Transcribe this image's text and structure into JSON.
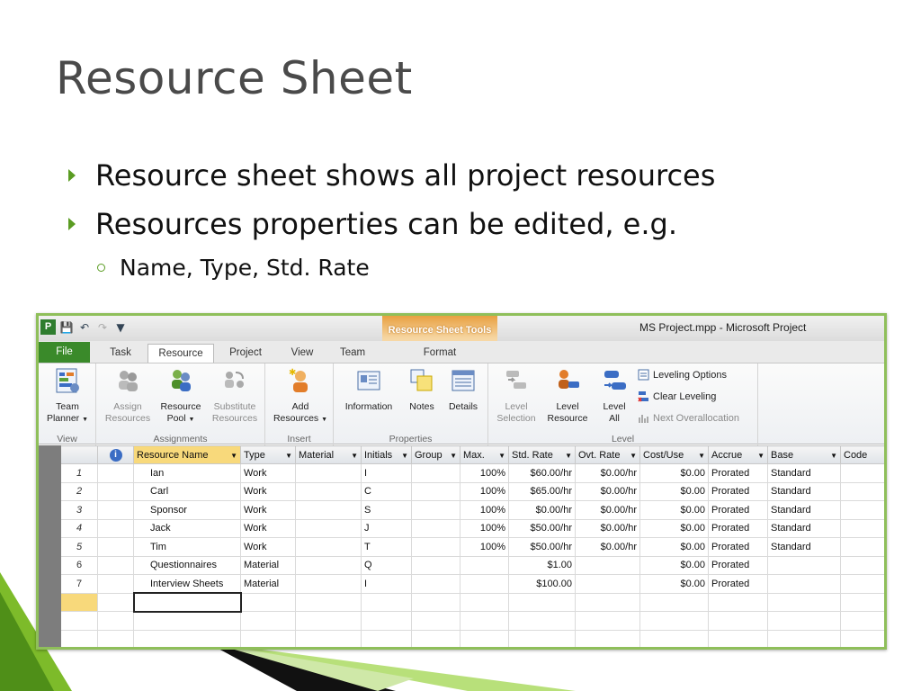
{
  "slide": {
    "title": "Resource Sheet",
    "bullets": [
      "Resource sheet shows all project resources",
      "Resources properties can be edited, e.g."
    ],
    "sub_bullet": "Name, Type, Std. Rate"
  },
  "app": {
    "window_title": "MS Project.mpp  -  Microsoft Project",
    "context_tab": "Resource Sheet Tools",
    "tabs": [
      "File",
      "Task",
      "Resource",
      "Project",
      "View",
      "Team",
      "Format"
    ],
    "active_tab": "Resource"
  },
  "ribbon": {
    "view": {
      "btn1": "Team",
      "btn2": "Planner",
      "label": "View"
    },
    "assignments": {
      "assign1": "Assign",
      "assign2": "Resources",
      "pool1": "Resource",
      "pool2": "Pool",
      "sub1": "Substitute",
      "sub2": "Resources",
      "label": "Assignments"
    },
    "insert": {
      "add1": "Add",
      "add2": "Resources",
      "label": "Insert"
    },
    "properties": {
      "info": "Information",
      "notes": "Notes",
      "details": "Details",
      "label": "Properties"
    },
    "level": {
      "sel1": "Level",
      "sel2": "Selection",
      "res1": "Level",
      "res2": "Resource",
      "all1": "Level",
      "all2": "All",
      "options": "Leveling Options",
      "clear": "Clear Leveling",
      "next": "Next Overallocation",
      "label": "Level"
    }
  },
  "grid": {
    "columns": [
      "",
      "",
      "Resource Name",
      "Type",
      "Material",
      "Initials",
      "Group",
      "Max.",
      "Std. Rate",
      "Ovt. Rate",
      "Cost/Use",
      "Accrue",
      "Base",
      "Code"
    ],
    "rows": [
      {
        "id": "1",
        "name": "Ian",
        "type": "Work",
        "material": "",
        "initials": "I",
        "group": "",
        "max": "100%",
        "std": "$60.00/hr",
        "ovt": "$0.00/hr",
        "cost": "$0.00",
        "accrue": "Prorated",
        "base": "Standard",
        "code": ""
      },
      {
        "id": "2",
        "name": "Carl",
        "type": "Work",
        "material": "",
        "initials": "C",
        "group": "",
        "max": "100%",
        "std": "$65.00/hr",
        "ovt": "$0.00/hr",
        "cost": "$0.00",
        "accrue": "Prorated",
        "base": "Standard",
        "code": ""
      },
      {
        "id": "3",
        "name": "Sponsor",
        "type": "Work",
        "material": "",
        "initials": "S",
        "group": "",
        "max": "100%",
        "std": "$0.00/hr",
        "ovt": "$0.00/hr",
        "cost": "$0.00",
        "accrue": "Prorated",
        "base": "Standard",
        "code": ""
      },
      {
        "id": "4",
        "name": "Jack",
        "type": "Work",
        "material": "",
        "initials": "J",
        "group": "",
        "max": "100%",
        "std": "$50.00/hr",
        "ovt": "$0.00/hr",
        "cost": "$0.00",
        "accrue": "Prorated",
        "base": "Standard",
        "code": ""
      },
      {
        "id": "5",
        "name": "Tim",
        "type": "Work",
        "material": "",
        "initials": "T",
        "group": "",
        "max": "100%",
        "std": "$50.00/hr",
        "ovt": "$0.00/hr",
        "cost": "$0.00",
        "accrue": "Prorated",
        "base": "Standard",
        "code": ""
      },
      {
        "id": "6",
        "name": "Questionnaires",
        "type": "Material",
        "material": "",
        "initials": "Q",
        "group": "",
        "max": "",
        "std": "$1.00",
        "ovt": "",
        "cost": "$0.00",
        "accrue": "Prorated",
        "base": "",
        "code": ""
      },
      {
        "id": "7",
        "name": "Interview Sheets",
        "type": "Material",
        "material": "",
        "initials": "I",
        "group": "",
        "max": "",
        "std": "$100.00",
        "ovt": "",
        "cost": "$0.00",
        "accrue": "Prorated",
        "base": "",
        "code": ""
      }
    ]
  },
  "colors": {
    "accent": "#5a9c22",
    "file_tab": "#3a8a2a",
    "context": "#e8a040",
    "selected_header": "#f8d97b"
  }
}
